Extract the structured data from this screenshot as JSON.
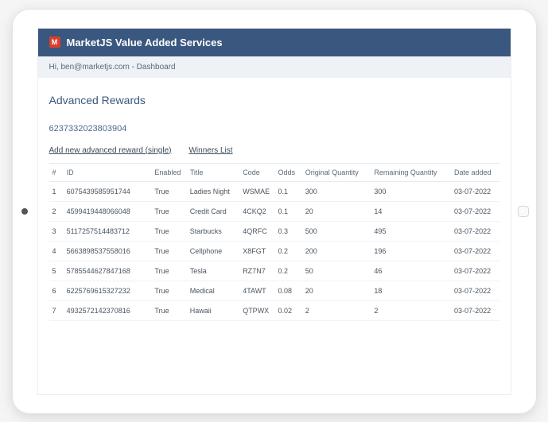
{
  "header": {
    "logo_letter": "M",
    "title": "MarketJS Value Added Services"
  },
  "subheader": {
    "greeting": "Hi, ben@marketjs.com - Dashboard"
  },
  "page": {
    "title": "Advanced Rewards",
    "record_id": "6237332023803904"
  },
  "actions": {
    "add_new": "Add new advanced reward (single)",
    "winners": "Winners List"
  },
  "table": {
    "headers": {
      "num": "#",
      "id": "ID",
      "enabled": "Enabled",
      "title": "Title",
      "code": "Code",
      "odds": "Odds",
      "original_qty": "Original Quantity",
      "remaining_qty": "Remaining Quantity",
      "date_added": "Date added"
    },
    "rows": [
      {
        "num": "1",
        "id": "6075439585951744",
        "enabled": "True",
        "title": "Ladies Night",
        "code": "WSMAE",
        "odds": "0.1",
        "oq": "300",
        "rq": "300",
        "date": "03-07-2022"
      },
      {
        "num": "2",
        "id": "4599419448066048",
        "enabled": "True",
        "title": "Credit Card",
        "code": "4CKQ2",
        "odds": "0.1",
        "oq": "20",
        "rq": "14",
        "date": "03-07-2022"
      },
      {
        "num": "3",
        "id": "5117257514483712",
        "enabled": "True",
        "title": "Starbucks",
        "code": "4QRFC",
        "odds": "0.3",
        "oq": "500",
        "rq": "495",
        "date": "03-07-2022"
      },
      {
        "num": "4",
        "id": "5663898537558016",
        "enabled": "True",
        "title": "Cellphone",
        "code": "X8FGT",
        "odds": "0.2",
        "oq": "200",
        "rq": "196",
        "date": "03-07-2022"
      },
      {
        "num": "5",
        "id": "5785544627847168",
        "enabled": "True",
        "title": "Tesla",
        "code": "RZ7N7",
        "odds": "0.2",
        "oq": "50",
        "rq": "46",
        "date": "03-07-2022"
      },
      {
        "num": "6",
        "id": "6225769615327232",
        "enabled": "True",
        "title": "Medical",
        "code": "4TAWT",
        "odds": "0.08",
        "oq": "20",
        "rq": "18",
        "date": "03-07-2022"
      },
      {
        "num": "7",
        "id": "4932572142370816",
        "enabled": "True",
        "title": "Hawaii",
        "code": "QTPWX",
        "odds": "0.02",
        "oq": "2",
        "rq": "2",
        "date": "03-07-2022"
      }
    ]
  }
}
